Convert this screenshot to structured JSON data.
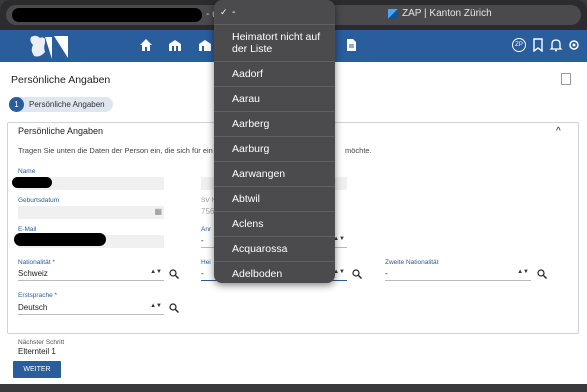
{
  "browser": {
    "url_partial": "- u",
    "site_title": "ZAP | Kanton Zürich"
  },
  "page": {
    "title": "Persönliche Angaben",
    "step": {
      "number": "1",
      "label": "Persönliche Angaben"
    }
  },
  "card": {
    "title": "Persönliche Angaben",
    "description": "Tragen Sie unten die Daten der Person ein, die sich für ein",
    "description_tail": "möchte."
  },
  "fields": {
    "name_label": "Name",
    "geburtsdatum_label": "Geburtsdatum",
    "sv_label": "SV N",
    "sv_value": "756",
    "email_label": "E-Mail",
    "anrede_label": "Anr",
    "anrede_value": "-",
    "nationalitaet_label": "Nationalität *",
    "nationalitaet_value": "Schweiz",
    "heimatort_label": "Hei",
    "heimatort_value": "-",
    "zweite_nat_label": "Zweite Nationalität",
    "zweite_nat_value": "-",
    "erstsprache_label": "Erstsprache *",
    "erstsprache_value": "Deutsch"
  },
  "footer": {
    "next_label": "Nächster Schritt",
    "next_value": "Elternteil 1",
    "button": "WEITER"
  },
  "dropdown": {
    "items": [
      "-",
      "Heimatort nicht auf der Liste",
      "Aadorf",
      "Aarau",
      "Aarberg",
      "Aarburg",
      "Aarwangen",
      "Abtwil",
      "Aclens",
      "Acquarossa",
      "Adelboden"
    ],
    "selected": "-"
  },
  "nav_badge": "ZP",
  "colors": {
    "header": "#2a5d9c",
    "accent": "#2a5d9c"
  }
}
